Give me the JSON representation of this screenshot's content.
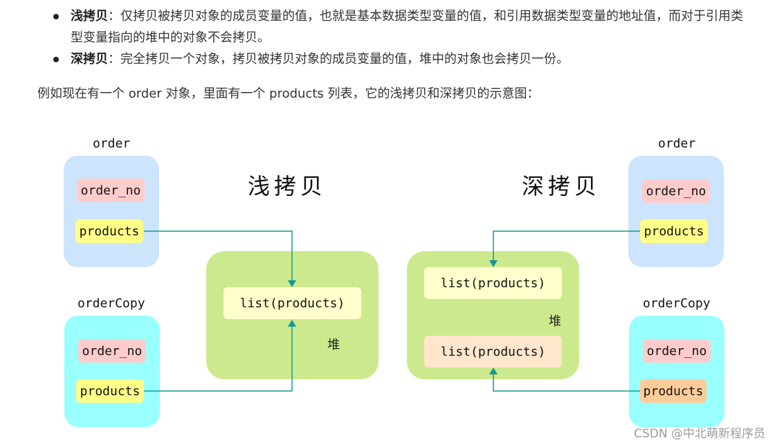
{
  "bullets": [
    {
      "term": "浅拷贝",
      "sep": "：",
      "text": "仅拷贝被拷贝对象的成员变量的值，也就是基本数据类型变量的值，和引用数据类型变量的地址值，而对于引用类型变量指向的堆中的对象不会拷贝。"
    },
    {
      "term": "深拷贝",
      "sep": "：",
      "text": "完全拷贝一个对象，拷贝被拷贝对象的成员变量的值，堆中的对象也会拷贝一份。"
    }
  ],
  "intro": "例如现在有一个 order 对象，里面有一个 products 列表，它的浅拷贝和深拷贝的示意图：",
  "diagram": {
    "shallow": {
      "title": "浅拷贝",
      "order": {
        "label": "order",
        "field1": "order_no",
        "field2": "products"
      },
      "order_copy": {
        "label": "orderCopy",
        "field1": "order_no",
        "field2": "products"
      },
      "heap": {
        "label": "堆",
        "list": "list(products)"
      }
    },
    "deep": {
      "title": "深拷贝",
      "order": {
        "label": "order",
        "field1": "order_no",
        "field2": "products"
      },
      "order_copy": {
        "label": "orderCopy",
        "field1": "order_no",
        "field2": "products"
      },
      "heap": {
        "label": "堆",
        "list1": "list(products)",
        "list2": "list(products)"
      }
    },
    "colors": {
      "order_bg": "#cce4fc",
      "order_copy_bg": "#99ffff",
      "order_no_bg": "#ffcccc",
      "products_bg": "#ffff88",
      "products_copy_bg": "#ffcc99",
      "heap_bg": "#cde98d",
      "list_bg": "#ffffcc",
      "list_copy_bg": "#ffe6cc",
      "arrow": "#119999"
    }
  },
  "watermark": "CSDN @中北萌新程序员"
}
